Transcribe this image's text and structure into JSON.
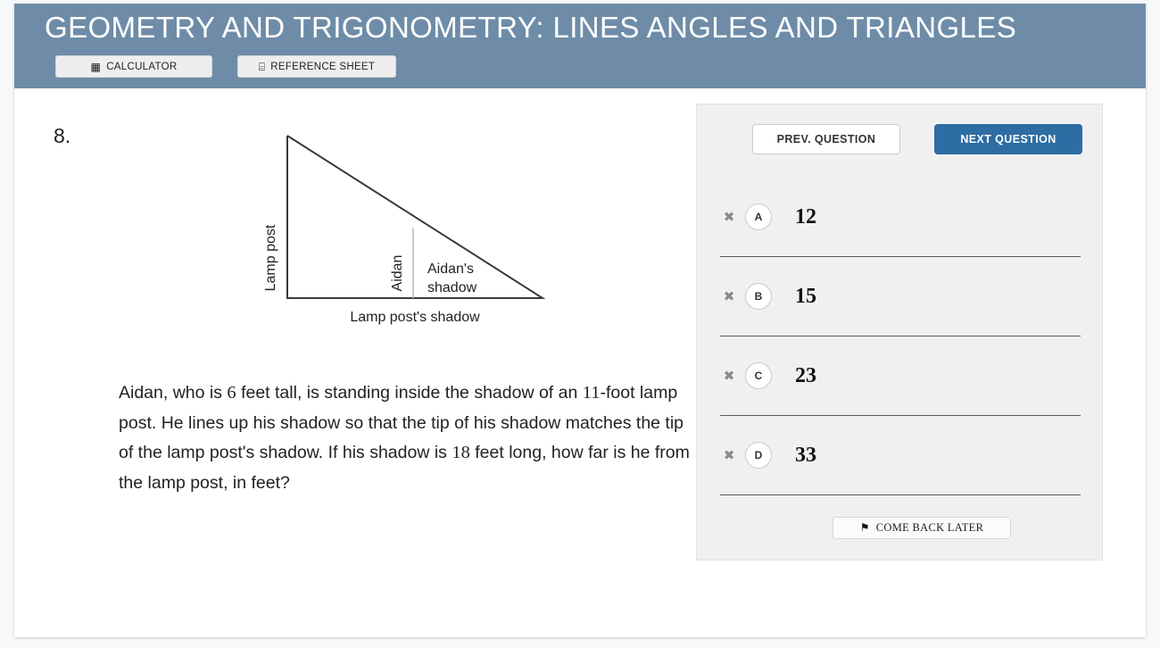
{
  "header": {
    "title": "GEOMETRY AND TRIGONOMETRY: LINES ANGLES AND TRIANGLES",
    "bg_color": "#6e8ca8",
    "tools": [
      {
        "label": "CALCULATOR",
        "icon": "calculator-icon",
        "glyph": "▦"
      },
      {
        "label": "REFERENCE SHEET",
        "icon": "book-icon",
        "glyph": "⌸"
      }
    ]
  },
  "question": {
    "number": "8.",
    "text_parts": [
      {
        "t": "Aidan, who is ",
        "n": false
      },
      {
        "t": "6",
        "n": true
      },
      {
        "t": " feet tall, is standing inside the shadow of an ",
        "n": false
      },
      {
        "t": "11",
        "n": true
      },
      {
        "t": "-foot lamp post. He lines up his shadow so that the tip of his shadow matches the tip of the lamp post's shadow. If his shadow is ",
        "n": false
      },
      {
        "t": "18",
        "n": true
      },
      {
        "t": " feet long, how far is he from the lamp post, in feet?",
        "n": false
      }
    ],
    "full_text": "Aidan, who is 6 feet tall, is standing inside the shadow of an 11-foot lamp post. He lines up his shadow so that the tip of his shadow matches the tip of the lamp post's shadow. If his shadow is 18 feet long, how far is he from the lamp post, in feet?"
  },
  "figure": {
    "labels": {
      "vertical_left": "Lamp post",
      "vertical_inner": "Aidan",
      "inner_right_line1": "Aidan's",
      "inner_right_line2": "shadow",
      "baseline_caption": "Lamp post's shadow"
    },
    "line_color": "#3a3a3a",
    "inner_line_color": "#b9b9b9"
  },
  "answer_panel": {
    "bg_color": "#f0f0f0",
    "nav": {
      "prev_label": "PREV. QUESTION",
      "next_label": "NEXT QUESTION",
      "next_color": "#2e6da4"
    },
    "choices": [
      {
        "letter": "A",
        "value": "12",
        "strike_glyph": "✖"
      },
      {
        "letter": "B",
        "value": "15",
        "strike_glyph": "✖"
      },
      {
        "letter": "C",
        "value": "23",
        "strike_glyph": "✖"
      },
      {
        "letter": "D",
        "value": "33",
        "strike_glyph": "✖"
      }
    ],
    "come_back_later": {
      "label": "COME BACK LATER",
      "icon": "flag-icon",
      "glyph": "⚑"
    }
  }
}
